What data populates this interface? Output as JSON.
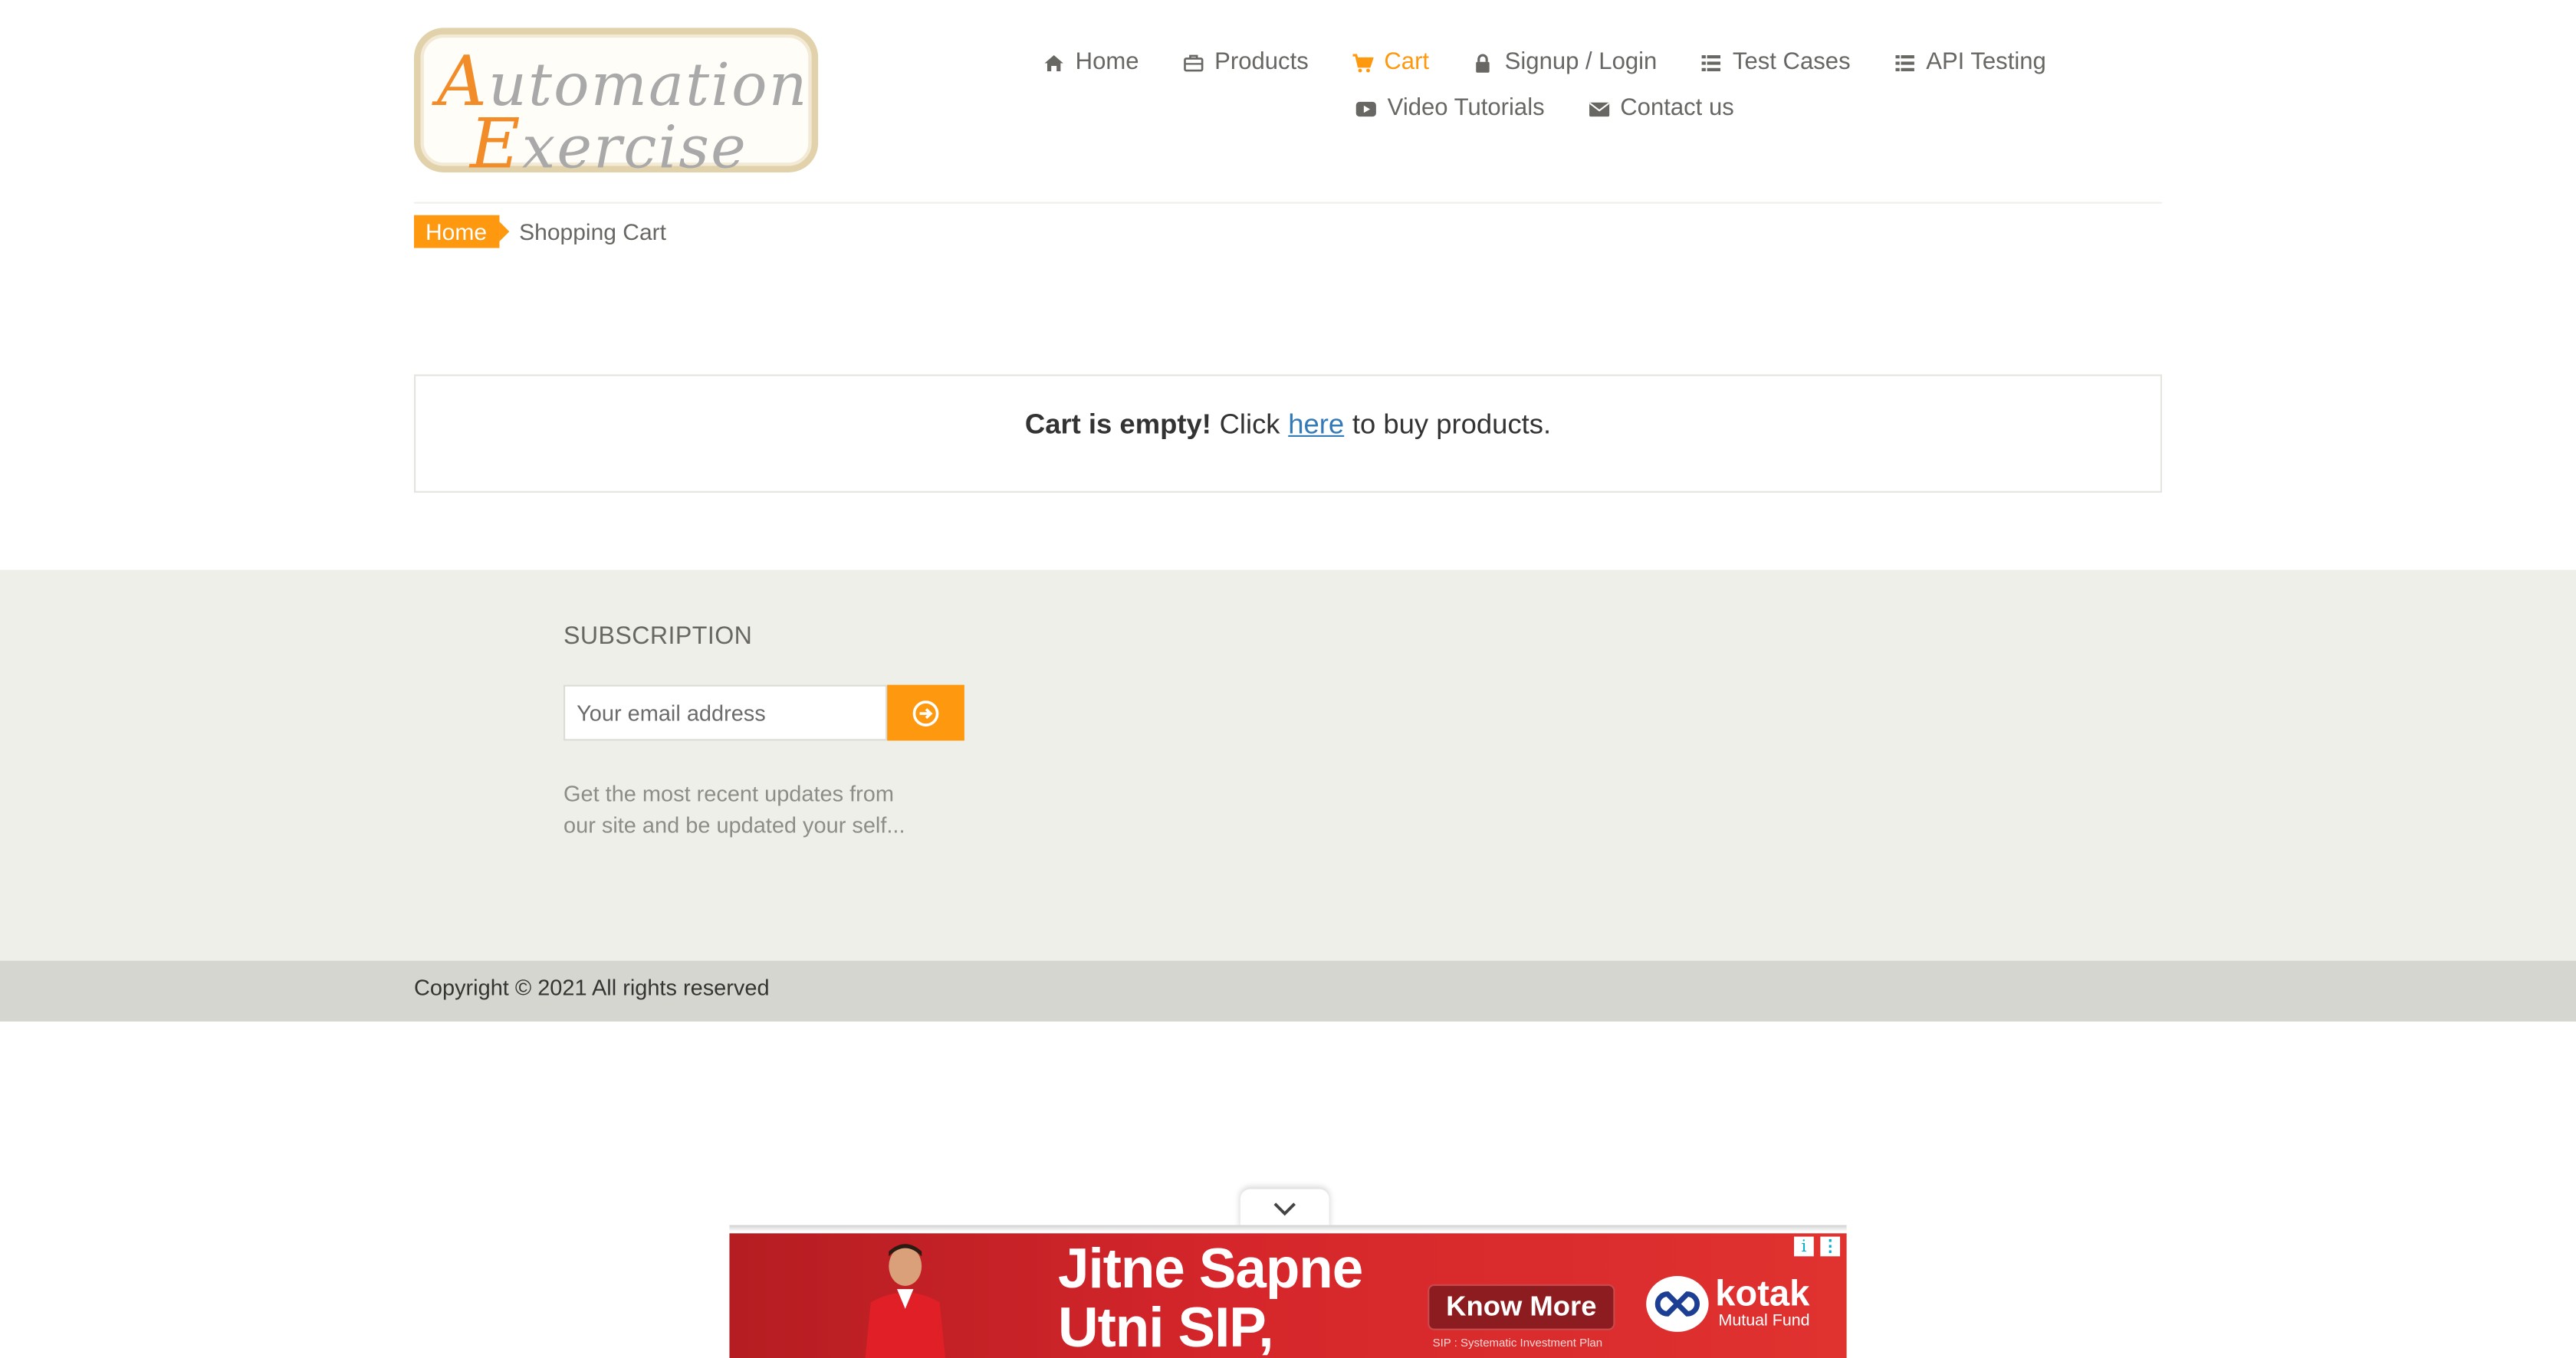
{
  "logo": {
    "line1_cap": "A",
    "line1_rest": "utomation",
    "line2_cap": "E",
    "line2_rest": "xercise"
  },
  "nav": {
    "row1": [
      {
        "label": "Home",
        "icon": "home-icon"
      },
      {
        "label": "Products",
        "icon": "products-icon"
      },
      {
        "label": "Cart",
        "icon": "cart-icon",
        "active": true
      },
      {
        "label": "Signup / Login",
        "icon": "lock-icon"
      },
      {
        "label": "Test Cases",
        "icon": "list-icon"
      },
      {
        "label": "API Testing",
        "icon": "list-icon"
      }
    ],
    "row2": [
      {
        "label": "Video Tutorials",
        "icon": "youtube-icon"
      },
      {
        "label": "Contact us",
        "icon": "envelope-icon"
      }
    ]
  },
  "breadcrumb": {
    "home": "Home",
    "current": "Shopping Cart"
  },
  "cart": {
    "empty_bold": "Cart is empty!",
    "empty_pre": "Click",
    "empty_link": "here",
    "empty_post": "to buy products."
  },
  "footer": {
    "subscription_title": "SUBSCRIPTION",
    "email_placeholder": "Your email address",
    "note": "Get the most recent updates from our site and be updated your self...",
    "copyright": "Copyright © 2021 All rights reserved"
  },
  "ad": {
    "headline_line1": "Jitne Sapne",
    "headline_line2": "Utni SIP,",
    "cta": "Know More",
    "fine_print": "SIP : Systematic Investment Plan",
    "brand": "kotak",
    "brand_sub": "Mutual Fund"
  },
  "colors": {
    "accent": "#fe980f",
    "text": "#696763",
    "footer_bg": "#efefea",
    "footer_bottom_bg": "#d6d6d0",
    "link": "#337ab7",
    "ad_red": "#d5262b"
  }
}
